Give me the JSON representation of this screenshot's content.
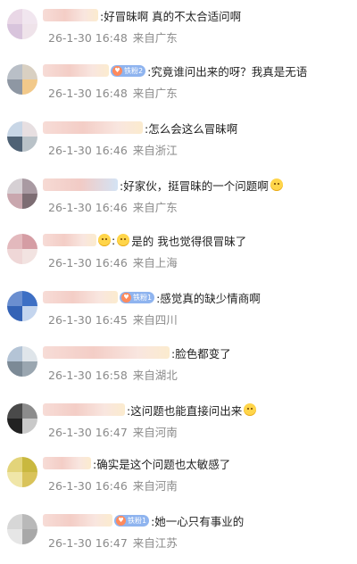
{
  "comments": [
    {
      "text": ":好冒昧啊 真的不太合适问啊",
      "date": "26-1-30 16:48",
      "location": "来自广东",
      "badge": "",
      "emoji": false,
      "emoji_before": false
    },
    {
      "text": ":究竟谁问出来的呀？我真是无语",
      "date": "26-1-30 16:48",
      "location": "来自广东",
      "badge": "铁粉2",
      "emoji": false,
      "emoji_before": false
    },
    {
      "text": ":怎么会这么冒昧啊",
      "date": "26-1-30 16:46",
      "location": "来自浙江",
      "badge": "",
      "emoji": false,
      "emoji_before": false
    },
    {
      "text": ":好家伙，挺冒昧的一个问题啊",
      "date": "26-1-30 16:46",
      "location": "来自广东",
      "badge": "",
      "emoji": true,
      "emoji_before": false
    },
    {
      "text": "是的 我也觉得很冒昧了",
      "date": "26-1-30 16:46",
      "location": "来自上海",
      "badge": "",
      "emoji": false,
      "emoji_before": true,
      "prefix": ":"
    },
    {
      "text": ":感觉真的缺少情商啊",
      "date": "26-1-30 16:45",
      "location": "来自四川",
      "badge": "铁粉1",
      "emoji": false,
      "emoji_before": false
    },
    {
      "text": ":脸色都变了",
      "date": "26-1-30 16:58",
      "location": "来自湖北",
      "badge": "",
      "emoji": false,
      "emoji_before": false
    },
    {
      "text": ":这问题也能直接问出来",
      "date": "26-1-30 16:47",
      "location": "来自河南",
      "badge": "",
      "emoji": true,
      "emoji_before": false
    },
    {
      "text": ":确实是这个问题也太敏感了",
      "date": "26-1-30 16:46",
      "location": "来自河南",
      "badge": "",
      "emoji": false,
      "emoji_before": false
    },
    {
      "text": ":她一心只有事业的",
      "date": "26-1-30 16:47",
      "location": "来自江苏",
      "badge": "铁粉1",
      "emoji": false,
      "emoji_before": false
    }
  ]
}
